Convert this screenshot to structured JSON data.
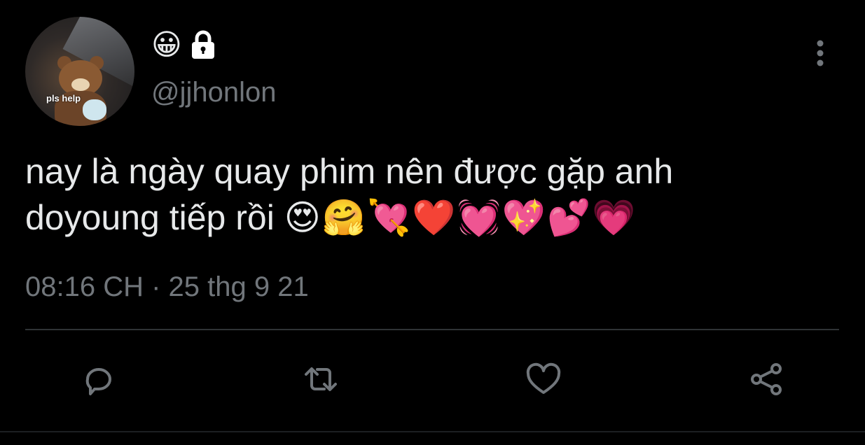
{
  "author": {
    "avatar_text": "pls help",
    "display_name_emoji": "😀",
    "protected_icon": "lock-icon",
    "handle": "@jjhonlon"
  },
  "tweet": {
    "text_line1": "nay là ngày quay phim nên được gặp anh",
    "text_line2": "doyoung tiếp rồi",
    "emojis": "😍🤗💘❤️💓💖💕💗",
    "timestamp": "08:16 CH · 25 thg 9 21"
  },
  "actions": {
    "reply": "reply-icon",
    "retweet": "retweet-icon",
    "like": "heart-icon",
    "share": "share-icon",
    "icon_color": "#71767b"
  },
  "menu": {
    "more": "more-vertical-icon"
  }
}
